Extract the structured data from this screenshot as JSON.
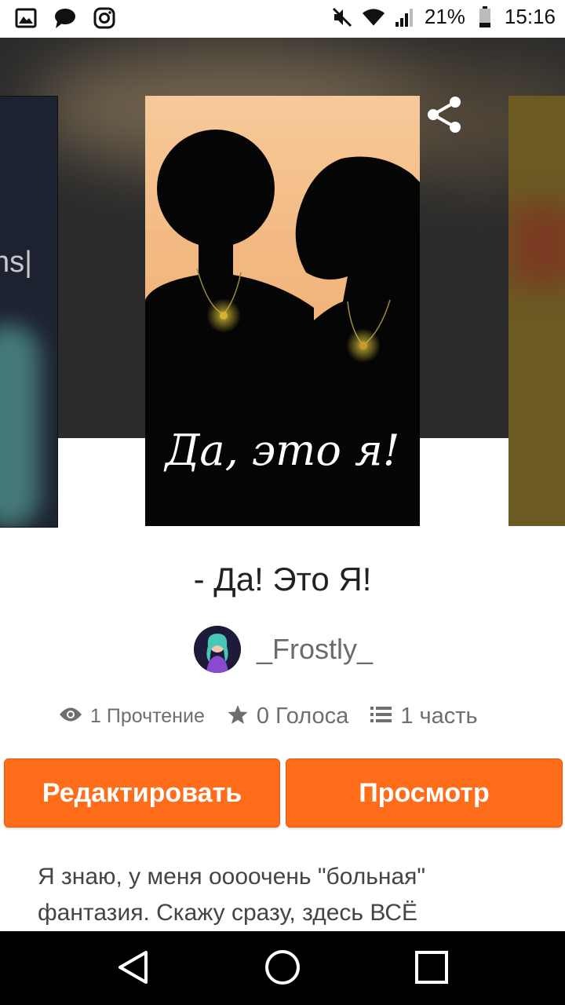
{
  "status_bar": {
    "battery": "21%",
    "time": "15:16"
  },
  "book": {
    "title": "- Да! Это Я!",
    "cover_caption": "Да, это я!",
    "author": "_Frostly_",
    "reads": "1 Прочтение",
    "votes": "0 Голоса",
    "parts": "1 часть",
    "description_lines": [
      "Я знаю, у меня оооочень \"больная\"",
      "фантазия. Скажу сразу, здесь ВСЁ"
    ]
  },
  "side_covers": {
    "left_text": "ns|"
  },
  "actions": {
    "edit_label": "Редактировать",
    "view_label": "Просмотр"
  },
  "colors": {
    "accent": "#ff6d1a",
    "header_bg": "#2b2b2b"
  },
  "icons": {
    "back": "arrow-back-icon",
    "share": "share-icon",
    "more": "more-vert-icon",
    "reads": "eye-icon",
    "votes": "star-icon",
    "parts": "list-icon"
  }
}
